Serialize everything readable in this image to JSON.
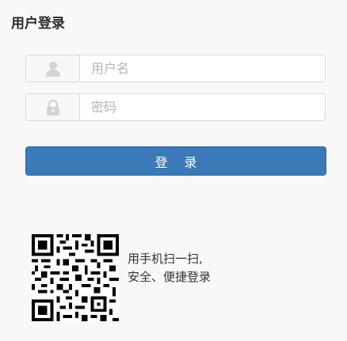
{
  "title": "用户登录",
  "username": {
    "placeholder": "用户名",
    "icon": "user-icon"
  },
  "password": {
    "placeholder": "密码",
    "icon": "lock-icon"
  },
  "login_button": "登 录",
  "qr": {
    "line1": "用手机扫一扫,",
    "line2": "安全、便捷登录"
  }
}
